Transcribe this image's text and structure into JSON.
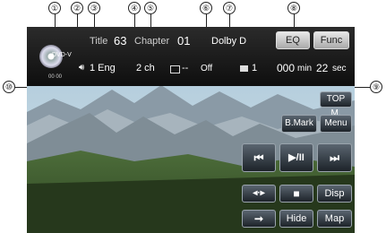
{
  "callouts": [
    "①",
    "②",
    "③",
    "④",
    "⑤",
    "⑥",
    "⑦",
    "⑧",
    "⑨",
    "⑩"
  ],
  "status": {
    "disc_label": "DVD-V",
    "title_label": "Title",
    "title_number": "63",
    "chapter_label": "Chapter",
    "chapter_number": "01",
    "audio_format": "Dolby D",
    "audio_language": "1 Eng",
    "audio_channels": "2 ch",
    "subtitle_value": "Off",
    "subtitle_language": "--",
    "angle_value": "1",
    "elapsed_min": "000",
    "min_unit": "min",
    "elapsed_sec": "22",
    "sec_unit": "sec",
    "disc_time_mark": "00 00"
  },
  "buttons": {
    "eq": "EQ",
    "func": "Func",
    "top_menu": "TOP M.",
    "bookmark": "B.Mark",
    "menu": "Menu",
    "prev": "⏮",
    "play_pause": "▶/II",
    "next": "⏭",
    "arrow_keys": "◂·▸",
    "stop": "■",
    "disp": "Disp",
    "hide_arrow": "➞",
    "hide": "Hide",
    "map": "Map"
  },
  "colors": {
    "accent_button": "#d9d9d9",
    "button_dark": "#2a3139",
    "status_bg": "#141414"
  },
  "icons": {
    "disc": "dvd-disc-icon",
    "audio": "speaker-icon",
    "subtitle": "subtitle-icon",
    "angle": "angle-camera-icon"
  }
}
